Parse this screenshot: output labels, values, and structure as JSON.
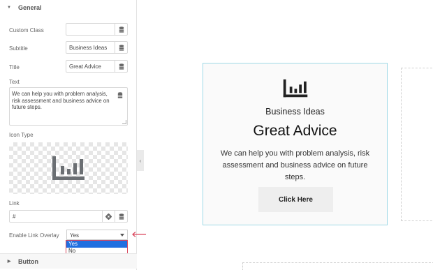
{
  "panel": {
    "general_section": "General",
    "button_section": "Button",
    "fields": {
      "custom_class": {
        "label": "Custom Class",
        "value": ""
      },
      "subtitle": {
        "label": "Subtitle",
        "value": "Business Ideas"
      },
      "title": {
        "label": "Title",
        "value": "Great Advice"
      },
      "text": {
        "label": "Text",
        "value": "We can help you with problem analysis, risk assessment and business advice on future steps."
      },
      "icon_type": {
        "label": "Icon Type",
        "icon": "bar-chart-icon"
      },
      "link": {
        "label": "Link",
        "placeholder": "#"
      },
      "enable_link_overlay": {
        "label": "Enable Link Overlay",
        "value": "Yes",
        "options": [
          "Yes",
          "No"
        ]
      }
    }
  },
  "card": {
    "icon": "bar-chart-icon",
    "subtitle": "Business Ideas",
    "title": "Great Advice",
    "text": "We can help you with problem analysis, risk assessment and business advice on future steps.",
    "button_label": "Click Here"
  },
  "colors": {
    "card_border": "#9fd9e6",
    "dropdown_highlight": "#1f6fe0",
    "annotation": "#d9455c"
  }
}
